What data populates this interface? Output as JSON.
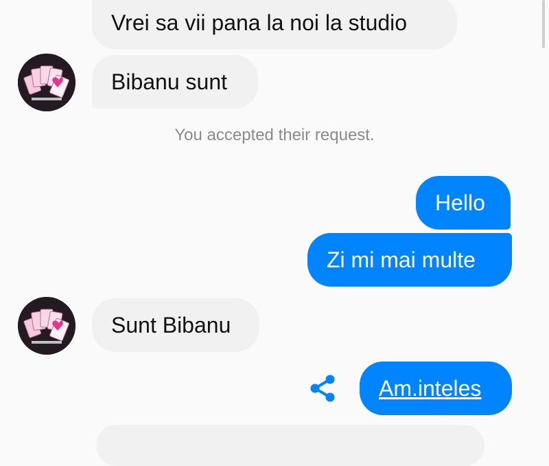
{
  "messages": [
    {
      "text": "Vrei sa vii pana la noi la studio",
      "direction": "incoming"
    },
    {
      "text": "Bibanu sunt",
      "direction": "incoming"
    },
    {
      "text": "Hello",
      "direction": "outgoing"
    },
    {
      "text": "Zi mi mai multe",
      "direction": "outgoing"
    },
    {
      "text": "Sunt Bibanu",
      "direction": "incoming"
    },
    {
      "text": "Am.inteles",
      "direction": "outgoing",
      "link": true
    }
  ],
  "system_note": "You accepted their request.",
  "avatar_icon": "playing-cards-logo-icon",
  "share_icon": "share-icon",
  "colors": {
    "outgoing_bubble": "#0084ff",
    "incoming_bubble": "#f1f1f1",
    "system_text": "#8a8a8a",
    "background": "#fafafa"
  }
}
